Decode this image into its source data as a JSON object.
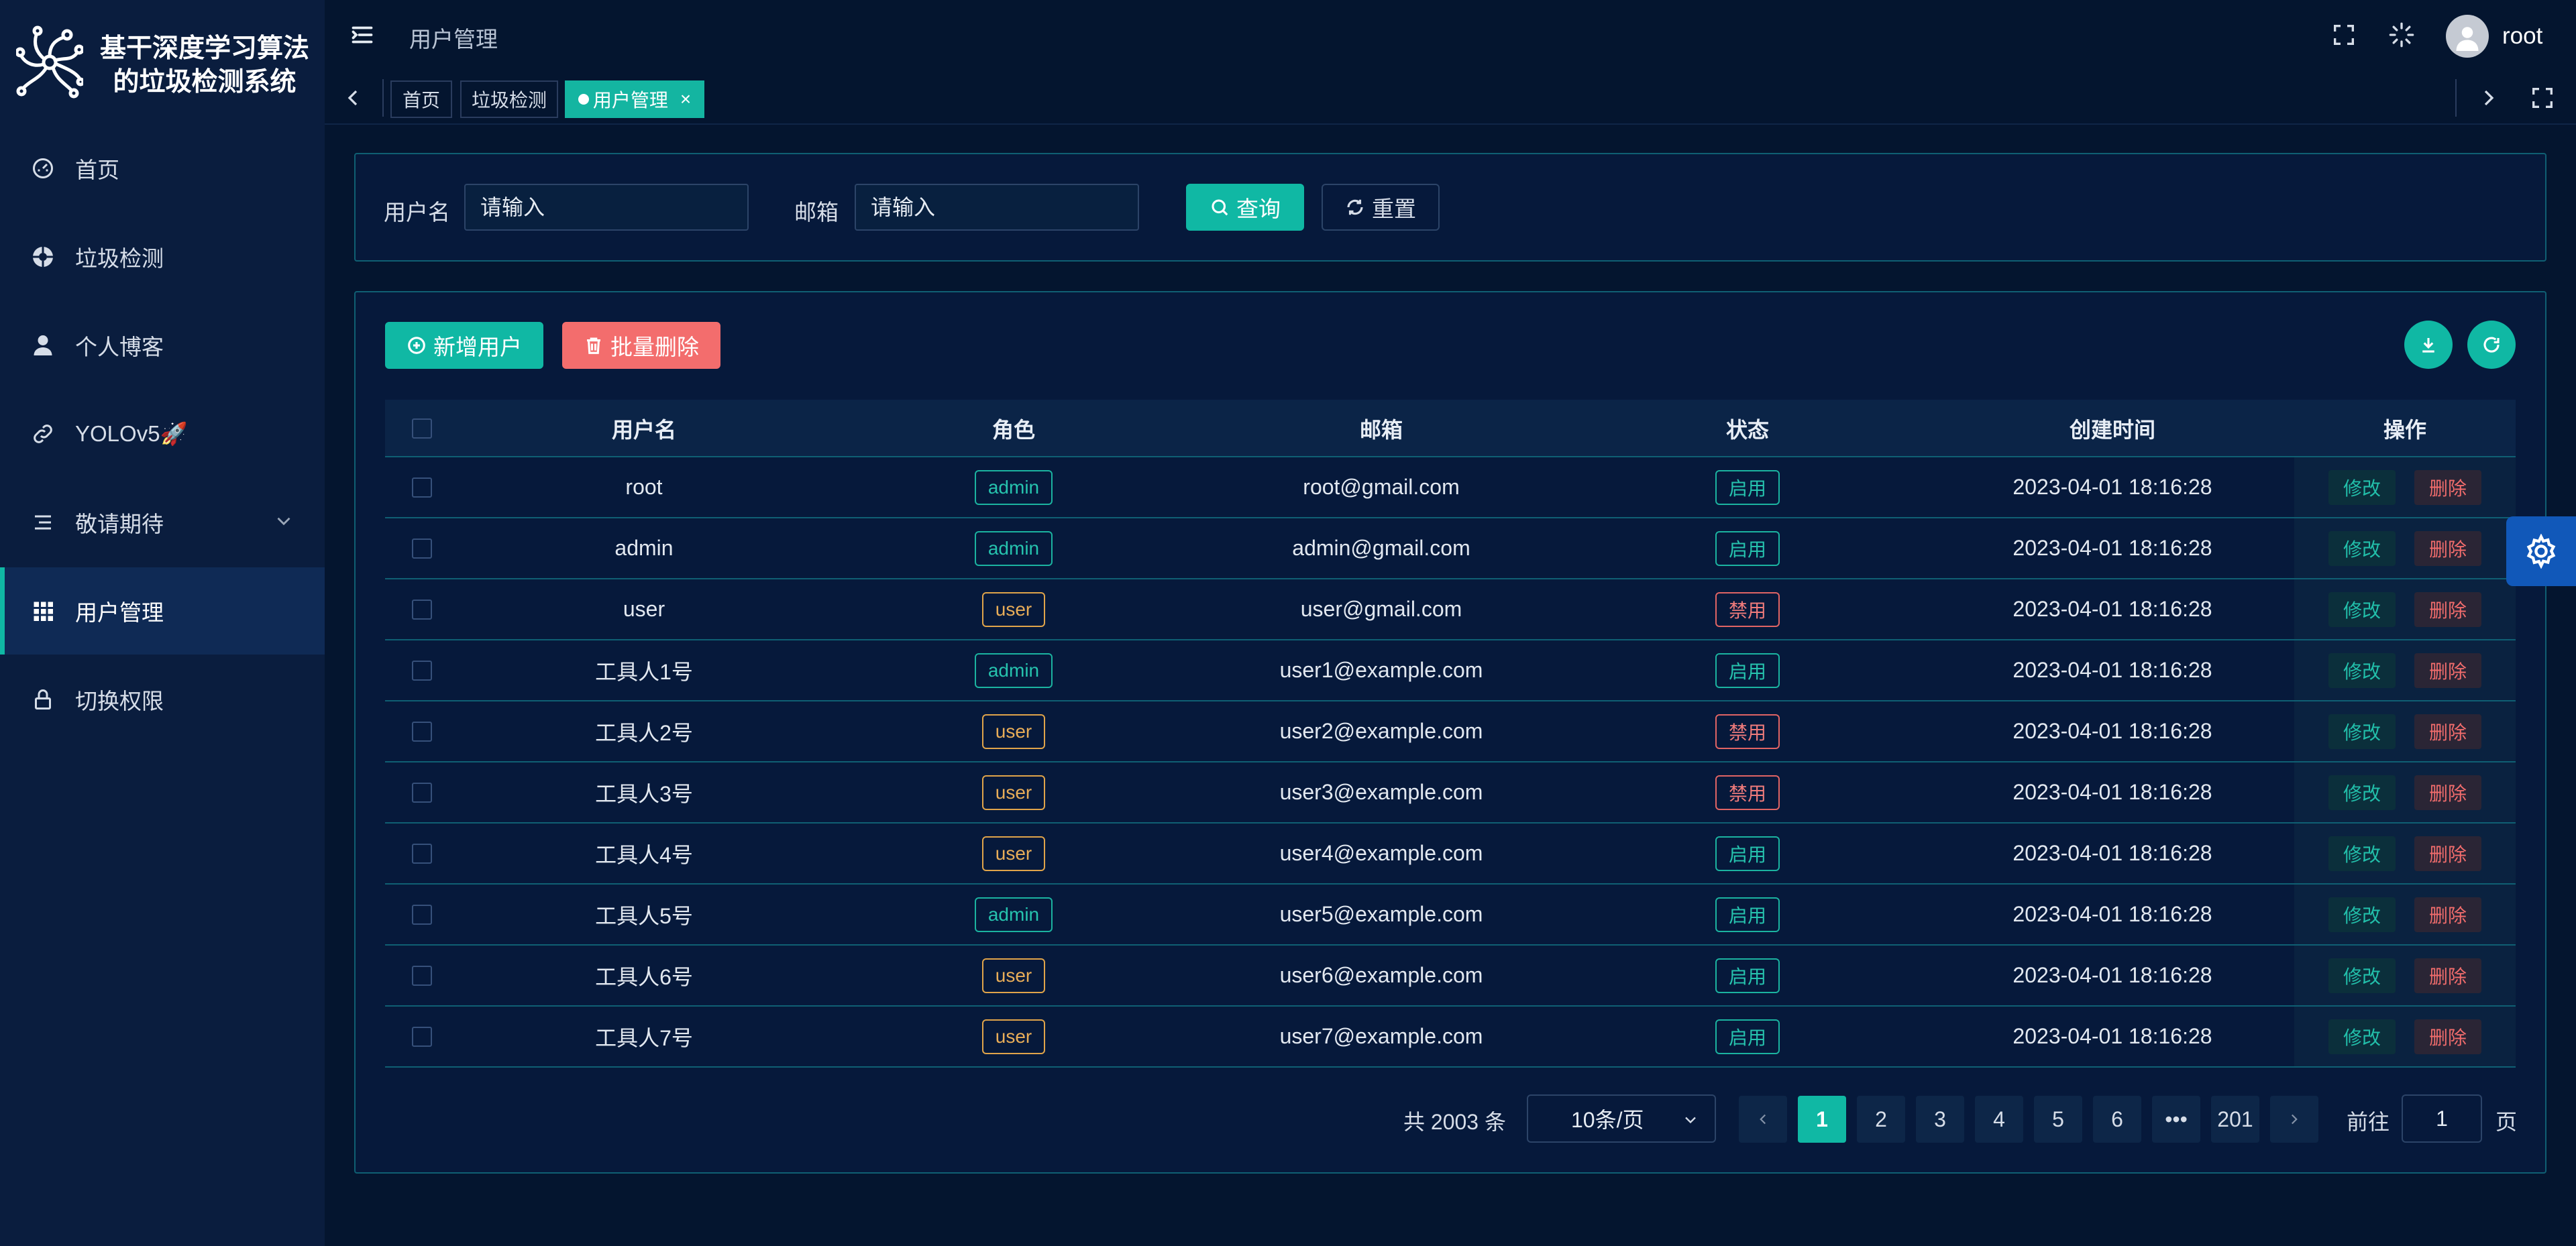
{
  "app": {
    "title_line1": "基干深度学习算法",
    "title_line2": "的垃圾检测系统"
  },
  "sidebar": {
    "items": [
      {
        "label": "首页",
        "icon": "dashboard-icon"
      },
      {
        "label": "垃圾检测",
        "icon": "aperture-icon"
      },
      {
        "label": "个人博客",
        "icon": "user-icon"
      },
      {
        "label": "YOLOv5🚀",
        "icon": "link-icon"
      },
      {
        "label": "敬请期待",
        "icon": "list-icon",
        "expandable": true
      },
      {
        "label": "用户管理",
        "icon": "grid-icon",
        "active": true
      },
      {
        "label": "切换权限",
        "icon": "lock-icon"
      }
    ]
  },
  "header": {
    "breadcrumb": "用户管理",
    "username": "root"
  },
  "tabs": [
    {
      "label": "首页"
    },
    {
      "label": "垃圾检测"
    },
    {
      "label": "用户管理",
      "active": true,
      "closable": true
    }
  ],
  "search": {
    "username_label": "用户名",
    "username_placeholder": "请输入",
    "email_label": "邮箱",
    "email_placeholder": "请输入",
    "query_label": "查询",
    "reset_label": "重置"
  },
  "toolbar": {
    "add_label": "新增用户",
    "batch_delete_label": "批量删除"
  },
  "table": {
    "columns": [
      "用户名",
      "角色",
      "邮箱",
      "状态",
      "创建时间",
      "操作"
    ],
    "edit_label": "修改",
    "delete_label": "删除",
    "rows": [
      {
        "username": "root",
        "role": "admin",
        "email": "root@gmail.com",
        "status": "启用",
        "created": "2023-04-01 18:16:28"
      },
      {
        "username": "admin",
        "role": "admin",
        "email": "admin@gmail.com",
        "status": "启用",
        "created": "2023-04-01 18:16:28"
      },
      {
        "username": "user",
        "role": "user",
        "email": "user@gmail.com",
        "status": "禁用",
        "created": "2023-04-01 18:16:28"
      },
      {
        "username": "工具人1号",
        "role": "admin",
        "email": "user1@example.com",
        "status": "启用",
        "created": "2023-04-01 18:16:28"
      },
      {
        "username": "工具人2号",
        "role": "user",
        "email": "user2@example.com",
        "status": "禁用",
        "created": "2023-04-01 18:16:28"
      },
      {
        "username": "工具人3号",
        "role": "user",
        "email": "user3@example.com",
        "status": "禁用",
        "created": "2023-04-01 18:16:28"
      },
      {
        "username": "工具人4号",
        "role": "user",
        "email": "user4@example.com",
        "status": "启用",
        "created": "2023-04-01 18:16:28"
      },
      {
        "username": "工具人5号",
        "role": "admin",
        "email": "user5@example.com",
        "status": "启用",
        "created": "2023-04-01 18:16:28"
      },
      {
        "username": "工具人6号",
        "role": "user",
        "email": "user6@example.com",
        "status": "启用",
        "created": "2023-04-01 18:16:28"
      },
      {
        "username": "工具人7号",
        "role": "user",
        "email": "user7@example.com",
        "status": "启用",
        "created": "2023-04-01 18:16:28"
      }
    ]
  },
  "pagination": {
    "total_text": "共 2003 条",
    "page_size": "10条/页",
    "pages": [
      "1",
      "2",
      "3",
      "4",
      "5",
      "6",
      "•••",
      "201"
    ],
    "current": "1",
    "goto_prefix": "前往",
    "goto_value": "1",
    "goto_suffix": "页"
  },
  "colors": {
    "accent": "#10b8a4",
    "danger": "#f36d6d",
    "warning": "#e0a44a",
    "background": "#04152f",
    "sidebar": "#0a1d3e"
  }
}
